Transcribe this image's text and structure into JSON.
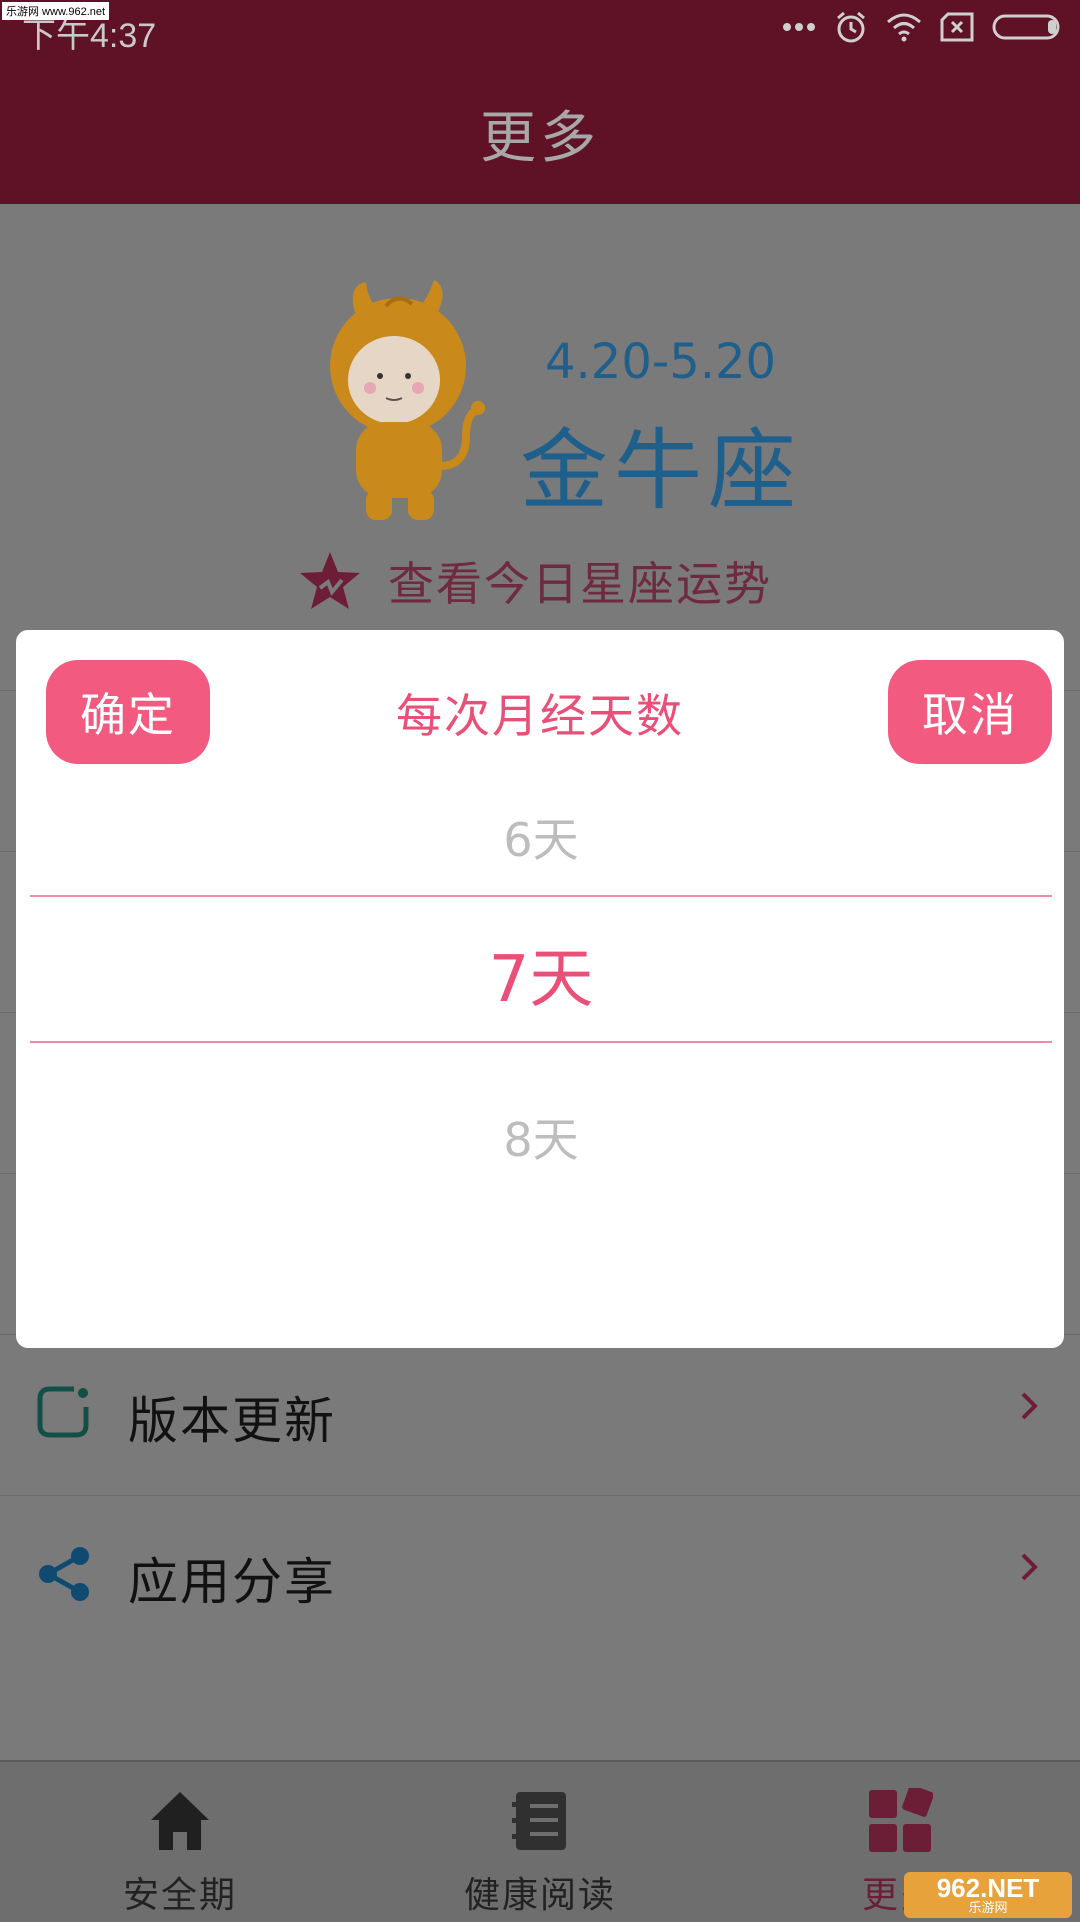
{
  "status_bar": {
    "time": "下午4:37",
    "watermark": "乐游网 www.962.net"
  },
  "app_bar": {
    "title": "更多"
  },
  "zodiac": {
    "date_range": "4.20-5.20",
    "name": "金牛座",
    "horoscope_link": "查看今日星座运势"
  },
  "list": {
    "items": [
      {
        "label": "版本更新"
      },
      {
        "label": "应用分享"
      }
    ]
  },
  "dialog": {
    "confirm_label": "确定",
    "title": "每次月经天数",
    "cancel_label": "取消",
    "picker": {
      "prev": "6天",
      "selected": "7天",
      "next": "8天"
    }
  },
  "bottom_nav": {
    "items": [
      {
        "label": "安全期",
        "icon": "home-icon"
      },
      {
        "label": "健康阅读",
        "icon": "book-icon"
      },
      {
        "label": "更多",
        "icon": "grid-icon"
      }
    ],
    "active_index": 2
  },
  "watermark_bottom": {
    "big": "962.NET",
    "small": "乐游网"
  },
  "colors": {
    "primary": "#5f1126",
    "accent": "#f25a7f",
    "zodiac_text": "#1e5f8c"
  }
}
